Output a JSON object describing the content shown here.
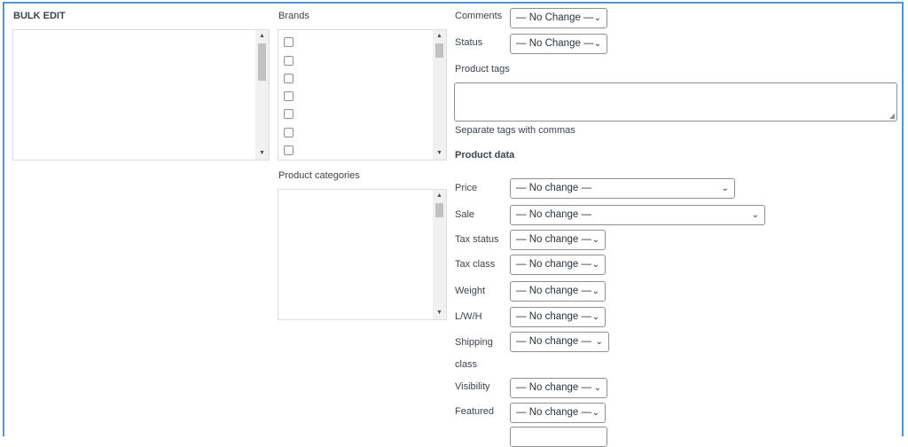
{
  "bulk_edit": {
    "title": "BULK EDIT"
  },
  "brands": {
    "label": "Brands",
    "checkbox_count": 7
  },
  "product_categories": {
    "label": "Product categories"
  },
  "comments": {
    "label": "Comments",
    "value": "— No Change —"
  },
  "status": {
    "label": "Status",
    "value": "— No Change —"
  },
  "product_tags": {
    "label": "Product tags",
    "value": "",
    "help": "Separate tags with commas"
  },
  "product_data": {
    "title": "Product data",
    "price": {
      "label": "Price",
      "value": "— No change —"
    },
    "sale": {
      "label": "Sale",
      "value": "— No change —"
    },
    "tax_status": {
      "label": "Tax status",
      "value": "— No change —"
    },
    "tax_class": {
      "label": "Tax class",
      "value": "— No change —"
    },
    "weight": {
      "label": "Weight",
      "value": "— No change —"
    },
    "lwh": {
      "label": "L/W/H",
      "value": "— No change —"
    },
    "shipping_class": {
      "label_line1": "Shipping",
      "label_line2": "class",
      "value": "— No change —"
    },
    "visibility": {
      "label": "Visibility",
      "value": "— No change —"
    },
    "featured": {
      "label": "Featured",
      "value": "— No change —"
    }
  },
  "icons": {
    "chevron": "chevron-down-icon",
    "scroll_up": "scroll-up-arrow-icon",
    "scroll_down": "scroll-down-arrow-icon",
    "resize": "resize-grip-icon"
  },
  "colors": {
    "frame_border": "#4f94d4",
    "input_border": "#8c8f94",
    "listbox_border": "#dcdcde"
  }
}
